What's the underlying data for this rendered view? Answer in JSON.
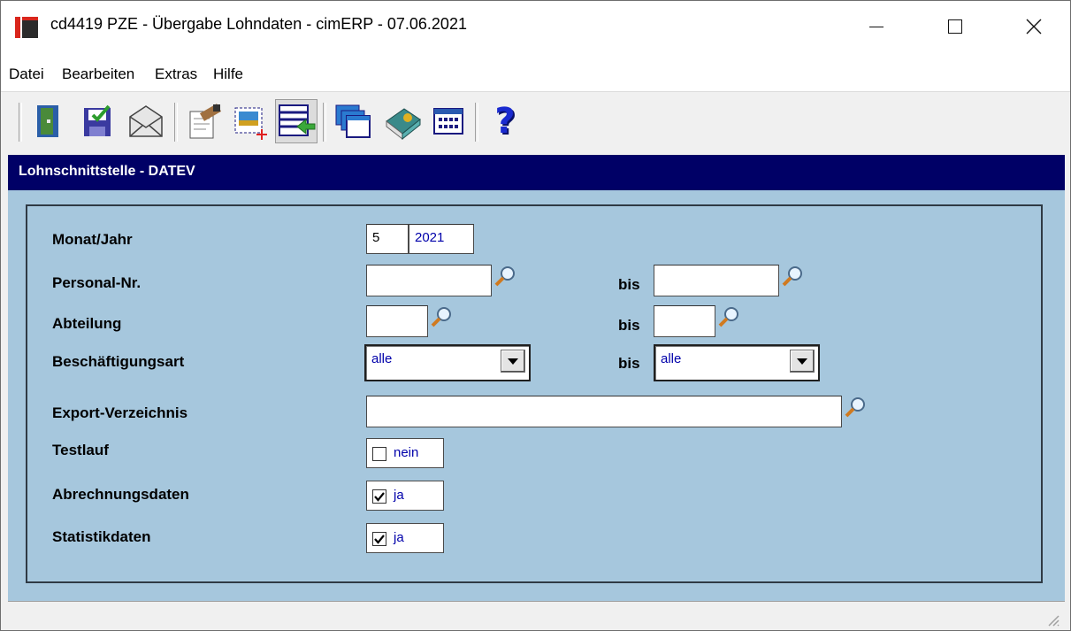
{
  "window": {
    "title": "cd4419 PZE - Übergabe Lohndaten - cimERP - 07.06.2021"
  },
  "menu": {
    "items": [
      "Datei",
      "Bearbeiten",
      "Extras",
      "Hilfe"
    ]
  },
  "toolbar": {
    "icons": [
      "exit-door-icon",
      "save-check-icon",
      "mail-icon",
      "edit-doc-icon",
      "new-record-icon",
      "transfer-list-icon",
      "windows-stack-icon",
      "book-icon",
      "calendar-icon",
      "help-icon"
    ],
    "help_glyph": "?"
  },
  "section": {
    "title": "Lohnschnittstelle - DATEV"
  },
  "form": {
    "monat_jahr_label": "Monat/Jahr",
    "monat_value": "5",
    "jahr_value": "2021",
    "personal_label": "Personal-Nr.",
    "personal_from": "",
    "personal_to": "",
    "abteilung_label": "Abteilung",
    "abteilung_from": "",
    "abteilung_to": "",
    "beschaeftigung_label": "Beschäftigungsart",
    "beschaeftigung_from": "alle",
    "beschaeftigung_to": "alle",
    "export_label": "Export-Verzeichnis",
    "export_value": "",
    "testlauf_label": "Testlauf",
    "testlauf_text": "nein",
    "testlauf_checked": false,
    "abrechnung_label": "Abrechnungsdaten",
    "abrechnung_text": "ja",
    "abrechnung_checked": true,
    "statistik_label": "Statistikdaten",
    "statistik_text": "ja",
    "statistik_checked": true,
    "bis_label": "bis"
  },
  "colors": {
    "header_bg": "#000066",
    "form_bg": "#a6c7dd",
    "value_text": "#0000aa"
  }
}
